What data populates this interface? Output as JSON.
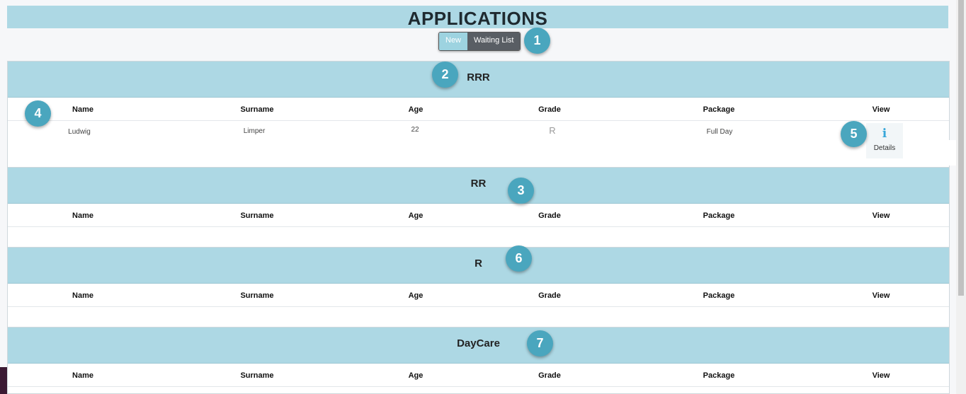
{
  "page": {
    "title": "APPLICATIONS"
  },
  "toggle": {
    "new_label": "New",
    "waiting_label": "Waiting List"
  },
  "badges": [
    "1",
    "2",
    "3",
    "4",
    "5",
    "6",
    "7"
  ],
  "columns": [
    "Name",
    "Surname",
    "Age",
    "Grade",
    "Package",
    "View"
  ],
  "sections": [
    {
      "title": "RRR",
      "rows": [
        {
          "name": "Ludwig",
          "surname": "Limper",
          "age": "22",
          "grade": "R",
          "package": "Full Day",
          "view": "Details"
        }
      ]
    },
    {
      "title": "RR",
      "rows": []
    },
    {
      "title": "R",
      "rows": []
    },
    {
      "title": "DayCare",
      "rows": []
    }
  ],
  "icons": {
    "details": "info-icon"
  },
  "colors": {
    "header_bg": "#add8e4",
    "badge": "#4aa6be",
    "toggle_active": "#595e64",
    "info": "#39a7d9"
  }
}
